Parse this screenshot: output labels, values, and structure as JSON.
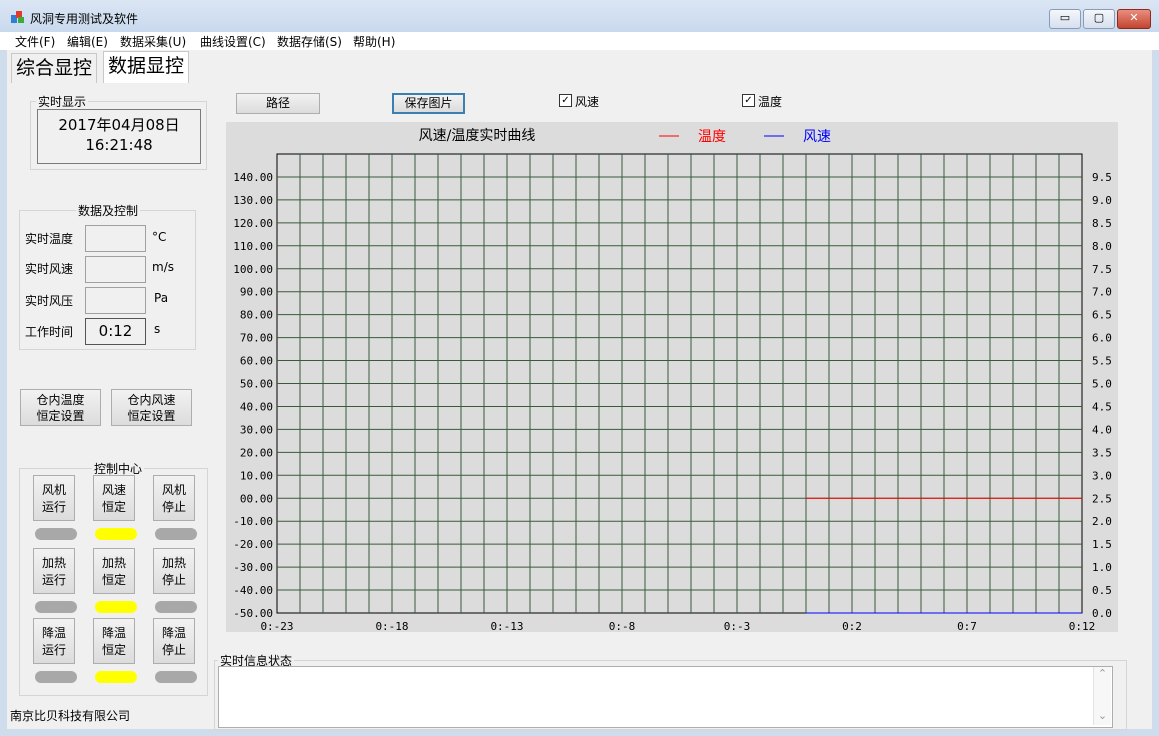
{
  "window": {
    "title": "风洞专用测试及软件",
    "min_label": "▭",
    "max_label": "▢",
    "close_label": "✕"
  },
  "menu": [
    "文件(F)",
    "编辑(E)",
    "数据采集(U)",
    "曲线设置(C)",
    "数据存储(S)",
    "帮助(H)"
  ],
  "tabs": [
    "综合显控",
    "数据显控"
  ],
  "realtime": {
    "group_label": "实时显示",
    "date": "2017年04月08日",
    "time": "16:21:48"
  },
  "data_control": {
    "group_label": "数据及控制",
    "rows": [
      {
        "label": "实时温度",
        "value": "",
        "unit": "°C"
      },
      {
        "label": "实时风速",
        "value": "",
        "unit": "m/s"
      },
      {
        "label": "实时风压",
        "value": "",
        "unit": "Pa"
      },
      {
        "label": "工作时间",
        "value": "0:12",
        "unit": "s"
      }
    ]
  },
  "settings_buttons": [
    {
      "line1": "仓内温度",
      "line2": "恒定设置"
    },
    {
      "line1": "仓内风速",
      "line2": "恒定设置"
    }
  ],
  "control_center": {
    "group_label": "控制中心",
    "rows": [
      [
        {
          "line1": "风机",
          "line2": "运行",
          "led": "off"
        },
        {
          "line1": "风速",
          "line2": "恒定",
          "led": "on"
        },
        {
          "line1": "风机",
          "line2": "停止",
          "led": "off"
        }
      ],
      [
        {
          "line1": "加热",
          "line2": "运行",
          "led": "off"
        },
        {
          "line1": "加热",
          "line2": "恒定",
          "led": "on"
        },
        {
          "line1": "加热",
          "line2": "停止",
          "led": "off"
        }
      ],
      [
        {
          "line1": "降温",
          "line2": "运行",
          "led": "off"
        },
        {
          "line1": "降温",
          "line2": "恒定",
          "led": "on"
        },
        {
          "line1": "降温",
          "line2": "停止",
          "led": "off"
        }
      ]
    ]
  },
  "toolbar": {
    "path_label": "路径",
    "save_image_label": "保存图片",
    "wind_checkbox_label": "风速",
    "wind_checked": true,
    "temp_checkbox_label": "温度",
    "temp_checked": true,
    "check_mark": "✓"
  },
  "chart_data": {
    "type": "line",
    "title": "风速/温度实时曲线",
    "x_ticks": [
      "0:-23",
      "0:-18",
      "0:-13",
      "0:-8",
      "0:-3",
      "0:2",
      "0:7",
      "0:12"
    ],
    "x_range": [
      -23,
      12
    ],
    "y_left_range": [
      -50,
      140
    ],
    "y_left_ticks": [
      "140.00",
      "130.00",
      "120.00",
      "110.00",
      "100.00",
      "90.00",
      "80.00",
      "70.00",
      "60.00",
      "50.00",
      "40.00",
      "30.00",
      "20.00",
      "10.00",
      "00.00",
      "-10.00",
      "-20.00",
      "-30.00",
      "-40.00",
      "-50.00"
    ],
    "y_right_range": [
      0,
      9.5
    ],
    "y_right_ticks": [
      "9.5",
      "9.0",
      "8.5",
      "8.0",
      "7.5",
      "7.0",
      "6.5",
      "6.0",
      "5.5",
      "5.0",
      "4.5",
      "4.0",
      "3.5",
      "3.0",
      "2.5",
      "2.0",
      "1.5",
      "1.0",
      "0.5",
      "0.0"
    ],
    "grid": true,
    "series": [
      {
        "name": "温度",
        "color": "#ff0000",
        "axis": "left",
        "x": [
          0,
          12
        ],
        "y": [
          0,
          0
        ]
      },
      {
        "name": "风速",
        "color": "#0000ff",
        "axis": "right",
        "x": [
          0,
          12
        ],
        "y": [
          0,
          0
        ]
      }
    ],
    "plot_bg": "#dcdcdc",
    "grid_color": "#3a5a3a"
  },
  "status": {
    "group_label": "实时信息状态",
    "scroll_up": "⌃",
    "scroll_down": "⌄"
  },
  "company": "南京比贝科技有限公司"
}
